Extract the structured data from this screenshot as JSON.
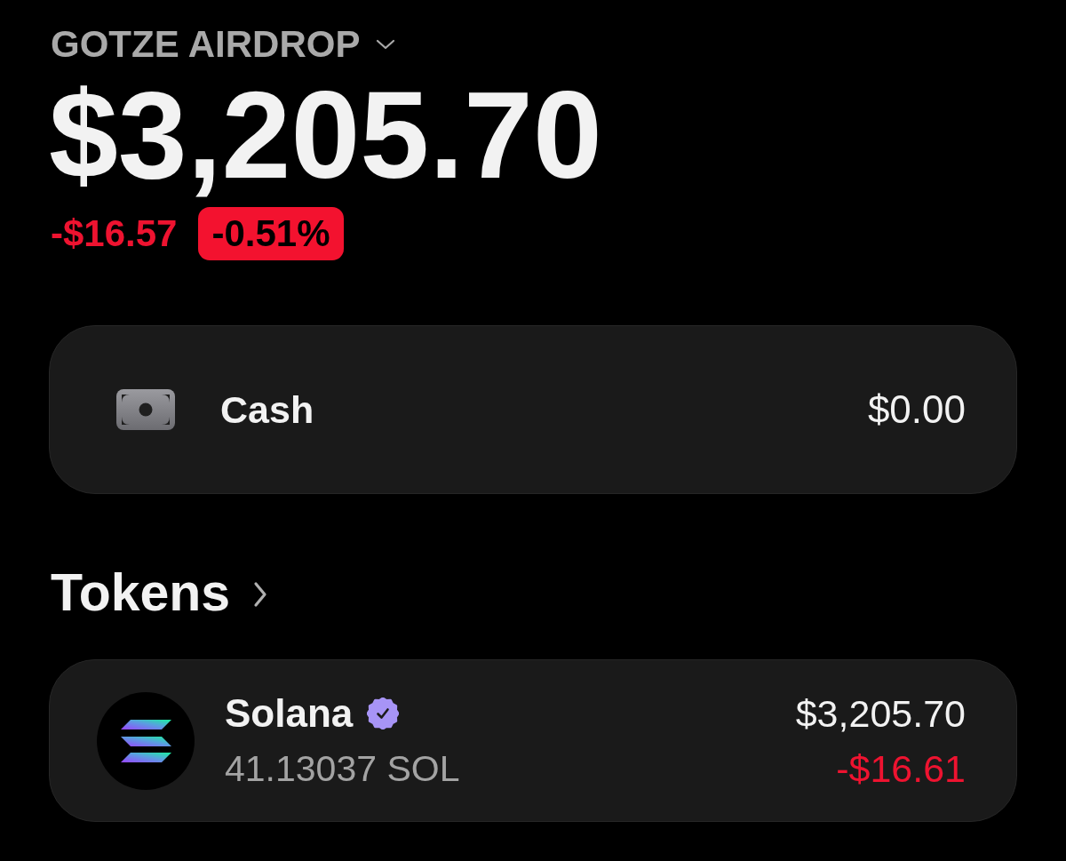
{
  "wallet": {
    "name": "GOTZE AIRDROP",
    "balance": "$3,205.70",
    "change": {
      "amount": "-$16.57",
      "percent": "-0.51%",
      "negative": true
    }
  },
  "cash": {
    "label": "Cash",
    "value": "$0.00"
  },
  "tokens": {
    "title": "Tokens",
    "items": [
      {
        "name": "Solana",
        "verified": true,
        "amount": "41.13037 SOL",
        "value": "$3,205.70",
        "change": "-$16.61",
        "negative": true
      }
    ]
  }
}
